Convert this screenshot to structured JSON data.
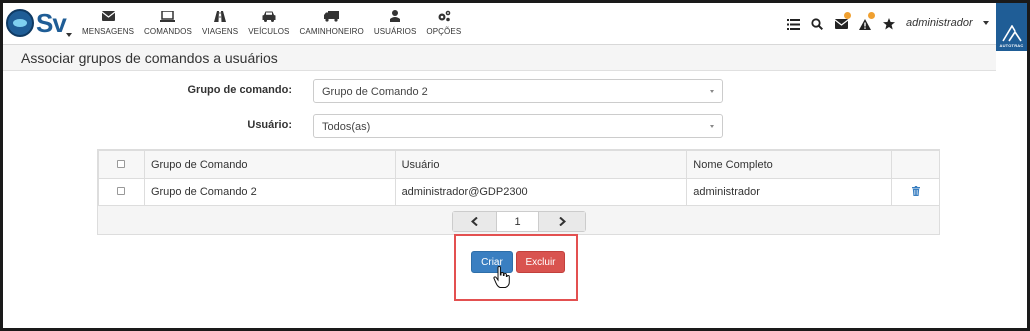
{
  "app": {
    "logo_text": "Sv",
    "brand_badge": "AUTOTRAC",
    "nav": [
      {
        "label": "MENSAGENS",
        "icon": "envelope-icon"
      },
      {
        "label": "COMANDOS",
        "icon": "laptop-icon"
      },
      {
        "label": "VIAGENS",
        "icon": "road-icon"
      },
      {
        "label": "VEÍCULOS",
        "icon": "car-icon"
      },
      {
        "label": "CAMINHONEIRO",
        "icon": "truck-icon"
      },
      {
        "label": "USUÁRIOS",
        "icon": "user-icon"
      },
      {
        "label": "OPÇÕES",
        "icon": "gears-icon"
      }
    ],
    "right_tools": [
      "list-icon",
      "search-icon",
      "mail-alert-icon",
      "warning-icon",
      "star-icon"
    ],
    "user": "administrador"
  },
  "page": {
    "title": "Associar grupos de comandos a usuários"
  },
  "form": {
    "grupo_label": "Grupo de comando:",
    "grupo_value": "Grupo de Comando 2",
    "usuario_label": "Usuário:",
    "usuario_value": "Todos(as)"
  },
  "table": {
    "columns": [
      "Grupo de Comando",
      "Usuário",
      "Nome Completo"
    ],
    "rows": [
      {
        "grupo": "Grupo de Comando 2",
        "usuario": "administrador@GDP2300",
        "nome": "administrador"
      }
    ]
  },
  "pagination": {
    "current_page": "1"
  },
  "actions": {
    "criar": "Criar",
    "excluir": "Excluir"
  },
  "colors": {
    "primary": "#3a7fc1",
    "danger": "#d9534f",
    "highlight": "#e35050",
    "brand": "#1f5d96"
  }
}
